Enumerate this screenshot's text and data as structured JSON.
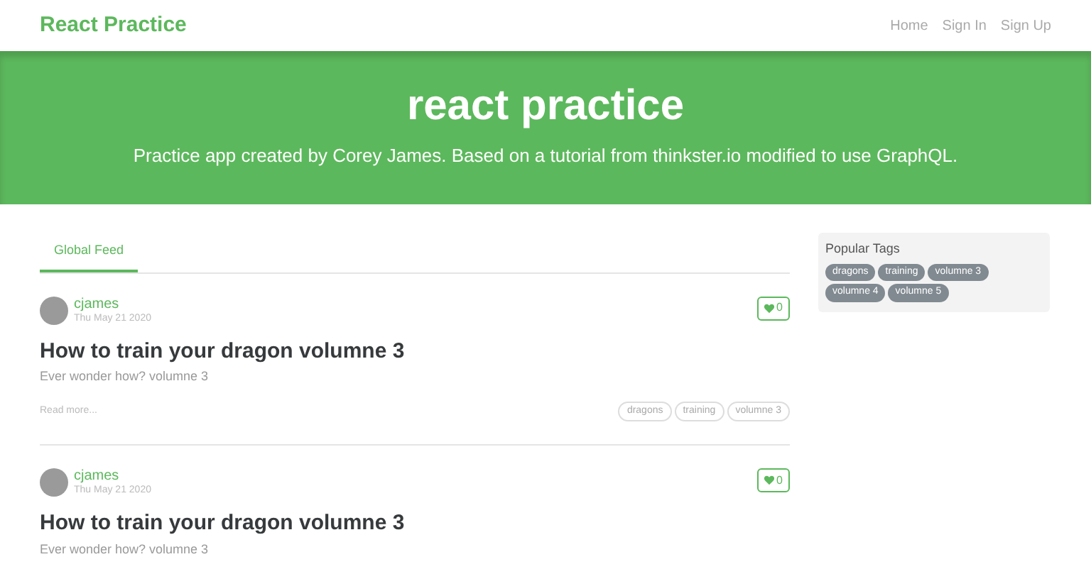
{
  "navbar": {
    "brand": "React Practice",
    "links": [
      {
        "label": "Home",
        "selected": false
      },
      {
        "label": "Sign In",
        "selected": false
      },
      {
        "label": "Sign Up",
        "selected": false
      }
    ]
  },
  "banner": {
    "title": "react practice",
    "subtitle": "Practice app created by Corey James. Based on a tutorial from thinkster.io modified to use GraphQL."
  },
  "feed_tabs": [
    {
      "label": "Global Feed",
      "selected": true
    }
  ],
  "articles": [
    {
      "author": "cjames",
      "date": "Thu May 21 2020",
      "favorites": "0",
      "favorited": false,
      "title": "How to train your dragon volumne 3",
      "description": "Ever wonder how? volumne 3",
      "read_more": "Read more...",
      "tags": [
        "dragons",
        "training",
        "volumne 3"
      ]
    },
    {
      "author": "cjames",
      "date": "Thu May 21 2020",
      "favorites": "0",
      "favorited": false,
      "title": "How to train your dragon volumne 3",
      "description": "Ever wonder how? volumne 3"
    }
  ],
  "sidebar": {
    "title": "Popular Tags",
    "tags": [
      "dragons",
      "training",
      "volumne 3",
      "volumne 4",
      "volumne 5"
    ]
  }
}
